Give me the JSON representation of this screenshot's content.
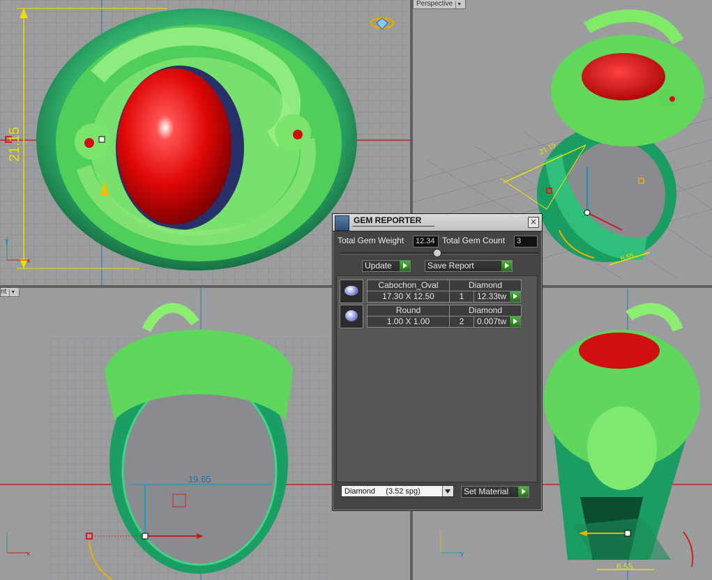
{
  "viewports": {
    "top_left": {
      "dimension_label": "21.15"
    },
    "top_right": {
      "name": "Perspective",
      "dimension_a": "21.15",
      "dimension_b": "6.55"
    },
    "bottom_left": {
      "name": "nt",
      "dimension_label": "19.65"
    },
    "bottom_right": {
      "dimension_label": "6.55"
    }
  },
  "gem_reporter": {
    "title": "GEM REPORTER",
    "close_glyph": "×",
    "total_weight_label": "Total Gem Weight",
    "total_weight_value": "12.34",
    "total_count_label": "Total Gem Count",
    "total_count_value": "3",
    "update_label": "Update",
    "save_report_label": "Save Report",
    "gems": [
      {
        "cut": "Cabochon_Oval",
        "material": "Diamond",
        "size": "17.30 X 12.50",
        "count": "1",
        "weight": "12.33tw"
      },
      {
        "cut": "Round",
        "material": "Diamond",
        "size": "1.00 X 1.00",
        "count": "2",
        "weight": "0.007tw"
      }
    ],
    "material_select": "Diamond     (3.52 spg)",
    "set_material_label": "Set Material"
  },
  "colors": {
    "ring_green": "#3fc070",
    "dragon_green": "#6ee06a",
    "gem_red": "#e01010",
    "dimension_yellow": "#f0e000",
    "panel_bg": "#444444",
    "play_green": "#36a02a"
  }
}
